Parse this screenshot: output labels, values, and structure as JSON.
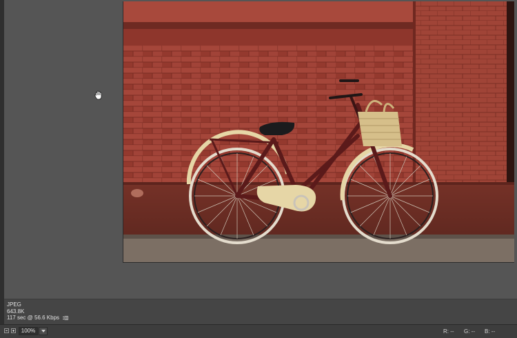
{
  "image": {
    "alt": "Burgundy bicycle with a woven basket leaning against a red brick wall"
  },
  "info": {
    "format": "JPEG",
    "size": "643.8K",
    "download": "117 sec @ 56.6 Kbps"
  },
  "statusbar": {
    "zoom": "100%",
    "r": "R: --",
    "g": "G: --",
    "b": "B: --"
  },
  "colors": {
    "canvas": "#555555",
    "panel": "#454545",
    "brick": "#9a3f33",
    "bike_frame": "#5b1a1a",
    "cream": "#e6d6a6"
  },
  "icons": [
    "hand-cursor-icon",
    "zoom-out-icon",
    "zoom-in-icon",
    "chevron-down-icon",
    "optimize-menu-icon"
  ]
}
